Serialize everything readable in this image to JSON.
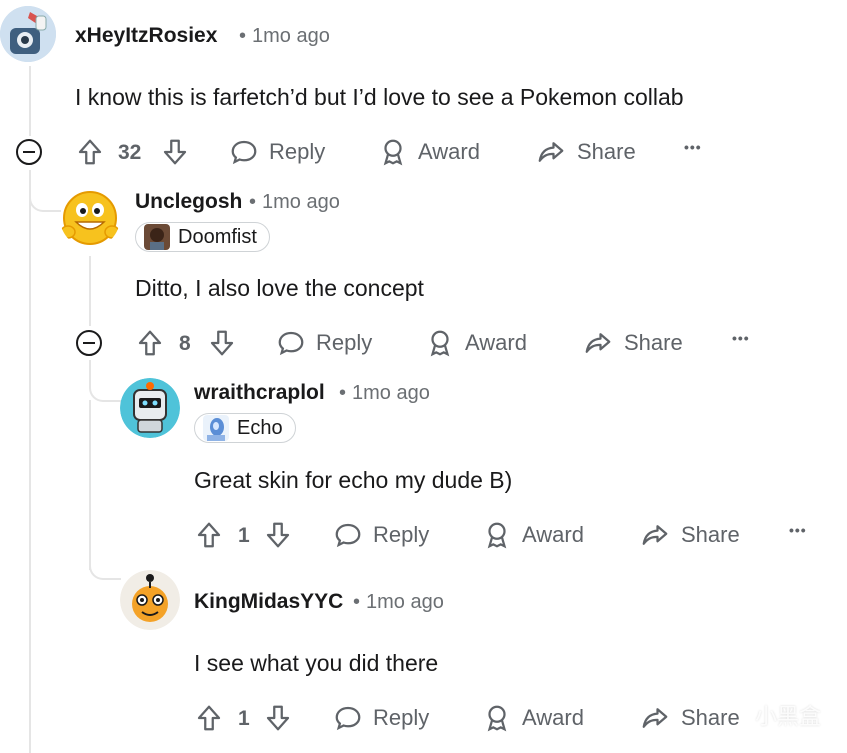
{
  "comments": [
    {
      "username": "xHeyItzRosiex",
      "timestamp": "1mo ago",
      "body": "I know this is farfetch’d but I’d love to see a Pokemon collab",
      "votes": "32",
      "actions": {
        "reply": "Reply",
        "award": "Award",
        "share": "Share",
        "more": "•••"
      }
    },
    {
      "username": "Unclegosh",
      "timestamp": "1mo ago",
      "flair": "Doomfist",
      "body": "Ditto, I also love the concept",
      "votes": "8",
      "actions": {
        "reply": "Reply",
        "award": "Award",
        "share": "Share",
        "more": "•••"
      }
    },
    {
      "username": "wraithcraplol",
      "timestamp": "1mo ago",
      "flair": "Echo",
      "body": "Great skin for echo my dude B)",
      "votes": "1",
      "actions": {
        "reply": "Reply",
        "award": "Award",
        "share": "Share",
        "more": "•••"
      }
    },
    {
      "username": "KingMidasYYC",
      "timestamp": "1mo ago",
      "body": "I see what you did there",
      "votes": "1",
      "actions": {
        "reply": "Reply",
        "award": "Award",
        "share": "Share",
        "more": "•••"
      }
    }
  ],
  "separator": "•",
  "watermark": "小黑盒",
  "colors": {
    "text": "#1a1a1b",
    "muted": "#5f6368",
    "line": "#e5e5e5"
  }
}
